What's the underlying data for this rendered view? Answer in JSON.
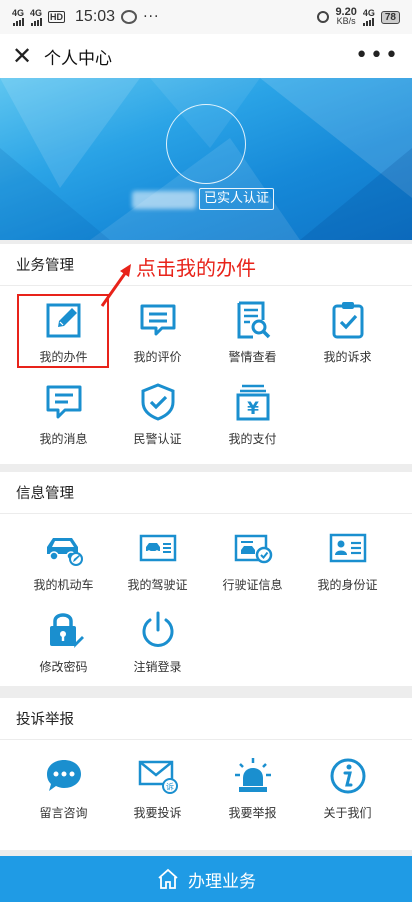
{
  "status": {
    "signal1": "4G",
    "signal2": "4G",
    "hd": "HD",
    "time": "15:03",
    "dots": "···",
    "speed_value": "9.20",
    "speed_unit": "KB/s",
    "network": "4G",
    "battery": "78"
  },
  "nav": {
    "close": "✕",
    "title": "个人中心",
    "more": "•••"
  },
  "profile": {
    "verify_label": "已实人认证"
  },
  "annotation": {
    "text": "点击我的办件"
  },
  "sections": [
    {
      "title": "业务管理",
      "items": [
        {
          "label": "我的办件",
          "icon": "edit-icon"
        },
        {
          "label": "我的评价",
          "icon": "chat-bubble-icon"
        },
        {
          "label": "警情查看",
          "icon": "doc-search-icon"
        },
        {
          "label": "我的诉求",
          "icon": "clipboard-check-icon"
        },
        {
          "label": "我的消息",
          "icon": "message-icon"
        },
        {
          "label": "民警认证",
          "icon": "shield-check-icon"
        },
        {
          "label": "我的支付",
          "icon": "yen-payment-icon"
        }
      ]
    },
    {
      "title": "信息管理",
      "items": [
        {
          "label": "我的机动车",
          "icon": "car-icon"
        },
        {
          "label": "我的驾驶证",
          "icon": "driver-license-icon"
        },
        {
          "label": "行驶证信息",
          "icon": "vehicle-license-icon"
        },
        {
          "label": "我的身份证",
          "icon": "id-card-icon"
        },
        {
          "label": "修改密码",
          "icon": "lock-icon"
        },
        {
          "label": "注销登录",
          "icon": "power-icon"
        }
      ]
    },
    {
      "title": "投诉举报",
      "items": [
        {
          "label": "留言咨询",
          "icon": "speech-dots-icon"
        },
        {
          "label": "我要投诉",
          "icon": "envelope-complaint-icon"
        },
        {
          "label": "我要举报",
          "icon": "alarm-light-icon"
        },
        {
          "label": "关于我们",
          "icon": "info-icon"
        }
      ],
      "complaint_badge": "诉"
    }
  ],
  "payment_symbol": "¥",
  "bottom": {
    "label": "办理业务",
    "icon": "home-icon"
  },
  "colors": {
    "accent": "#1f9be5",
    "icon": "#1a8fcf",
    "annotation": "#e8231a"
  }
}
